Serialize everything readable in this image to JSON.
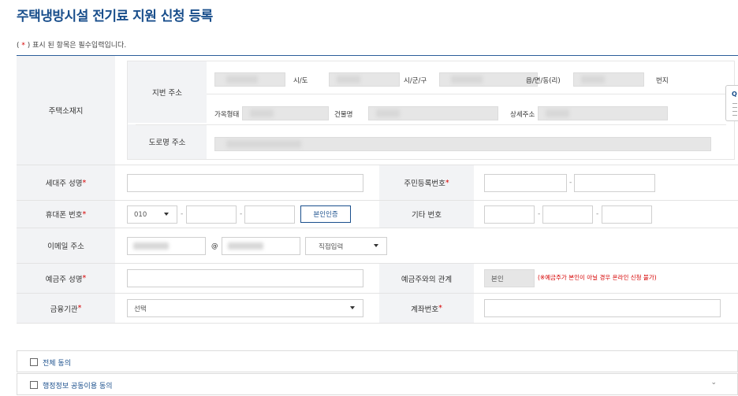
{
  "page_title": "주택냉방시설 전기료 지원 신청 등록",
  "required_note": {
    "prefix": "( ",
    "star": "*",
    "suffix": " ) 표시 된 항목은 필수입력입니다."
  },
  "address": {
    "label": "주택소재지",
    "jibun_label": "지번 주소",
    "sido": "시/도",
    "sigungu": "시/군/구",
    "eupmyeon": "읍/면/동(리)",
    "bunji": "번지",
    "house_type": "가옥형태",
    "building": "건물명",
    "detail": "상세주소",
    "road_label": "도로명 주소"
  },
  "householder": {
    "label": "세대주 성명",
    "star": "*"
  },
  "resident_no": {
    "label": "주민등록번호",
    "star": "*",
    "dash": "-"
  },
  "mobile": {
    "label": "휴대폰 번호",
    "star": "*",
    "prefix": "010",
    "dash": "-",
    "auth_button": "본인인증"
  },
  "other_phone": {
    "label": "기타 번호",
    "dash": "-"
  },
  "email": {
    "label": "이메일 주소",
    "at": "@",
    "domain_select": "직접입력"
  },
  "depositor": {
    "label": "예금주 성명",
    "star": "*"
  },
  "relation": {
    "label": "예금주와의 관계",
    "value": "본인",
    "note": "(※예금주가 본인이 아닐 경우 온라인 신청 불가)"
  },
  "bank": {
    "label": "금융기관",
    "star": "*",
    "select": "선택"
  },
  "account": {
    "label": "계좌번호",
    "star": "*"
  },
  "agreements": [
    {
      "label": "전체 동의"
    },
    {
      "label": "행정정보 공동이용 동의"
    }
  ],
  "side_tab": {
    "letter": "Q"
  },
  "colors": {
    "brand": "#1a4f8c",
    "required": "#d60000",
    "label_bg": "#f2f3f5"
  }
}
